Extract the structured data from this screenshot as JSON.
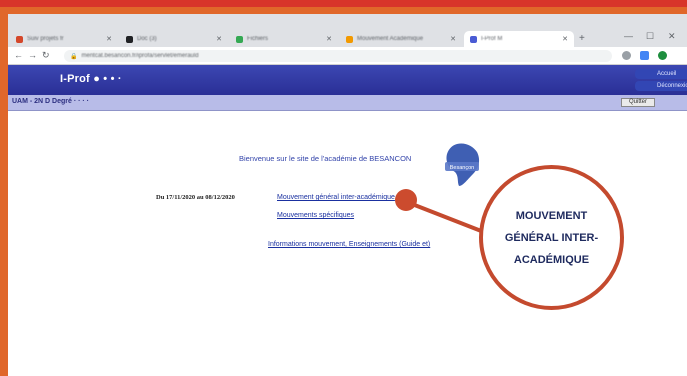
{
  "browser": {
    "tabs": [
      {
        "title": "Suiv projets fr",
        "favicon_color": "#d4472a"
      },
      {
        "title": "Doc (3)",
        "favicon_color": "#202124"
      },
      {
        "title": "Fichiers",
        "favicon_color": "#34a853"
      },
      {
        "title": "Mouvement Académique",
        "favicon_color": "#f29900"
      },
      {
        "title": "I-Prof M",
        "favicon_color": "#4a5bd4"
      }
    ],
    "url": "mentcat.besancon.fr/iprofa/servlet/emerauld",
    "window_controls": [
      "—",
      "☐",
      "✕"
    ]
  },
  "header": {
    "title": "I-Prof",
    "title_dots": "● • • ·",
    "right_buttons": [
      "Accueil",
      "Déconnexion"
    ]
  },
  "subbar": {
    "text": "UAM - 2N D Degré · · · ·",
    "close_label": "Quitter"
  },
  "content": {
    "welcome": "Bienvenue sur le site de l'académie de BESANCON",
    "map_label": "Besançon",
    "date_range": "Du 17/11/2020 au 08/12/2020",
    "links": [
      "Mouvement général inter-académique",
      "Mouvements spécifiques",
      "Informations mouvement, Enseignements (Guide et)"
    ]
  },
  "callout": {
    "text": "MOUVEMENT GÉNÉRAL INTER-ACADÉMIQUE"
  },
  "colors": {
    "frame": "#e0672a",
    "accent_red": "#c44a2e",
    "iprof_blue": "#2a2f96",
    "link_blue": "#1a30a0"
  }
}
